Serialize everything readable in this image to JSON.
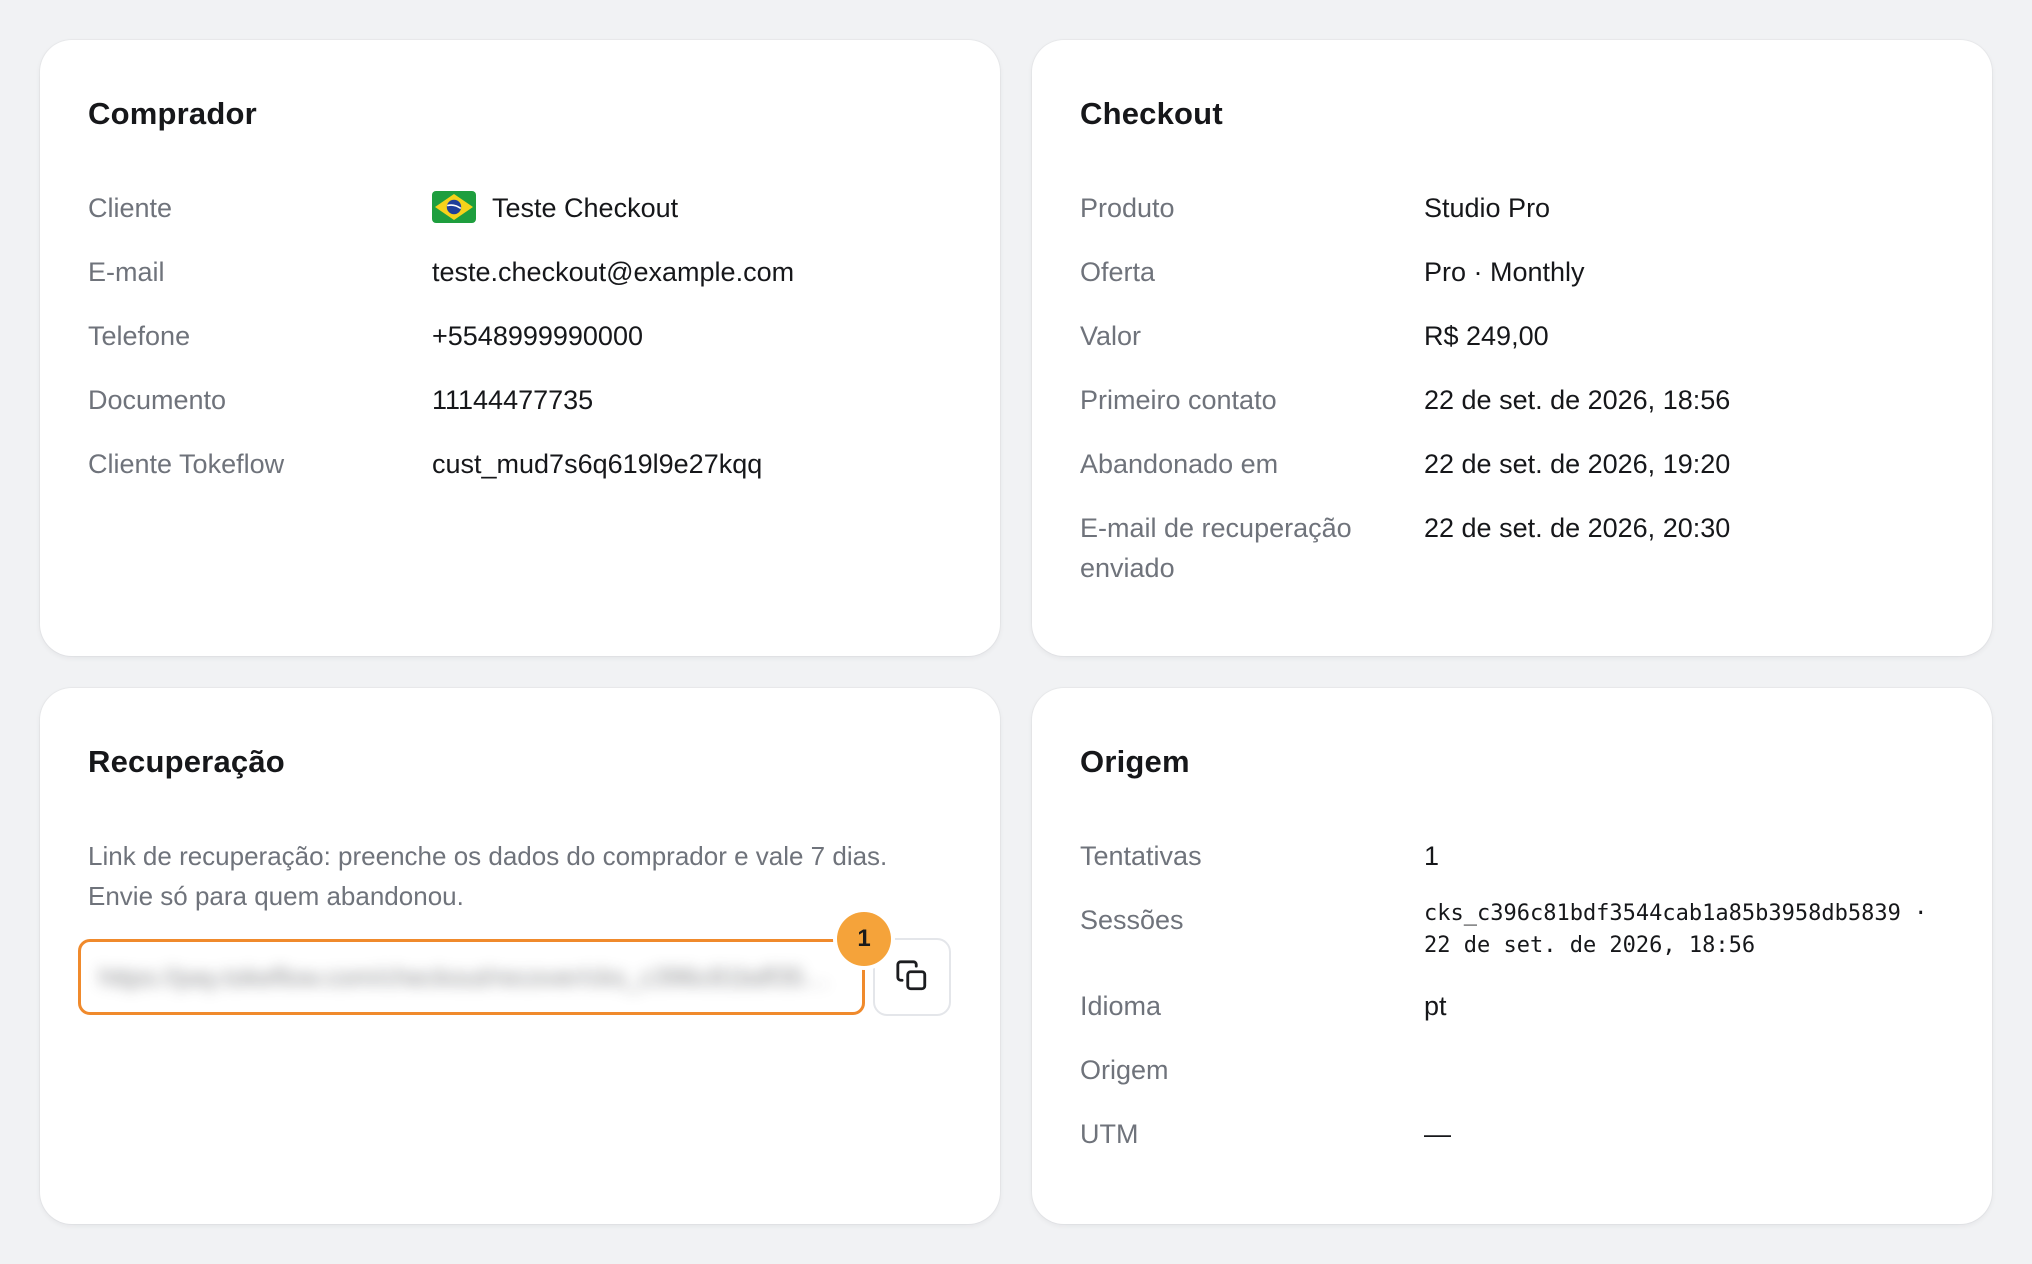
{
  "buyer": {
    "title": "Comprador",
    "rows": [
      {
        "label": "Cliente",
        "value": "Teste Checkout",
        "flag": "brazil-flag-icon"
      },
      {
        "label": "E-mail",
        "value": "teste.checkout@example.com"
      },
      {
        "label": "Telefone",
        "value": "+5548999990000"
      },
      {
        "label": "Documento",
        "value": "11144477735"
      },
      {
        "label": "Cliente Tokeflow",
        "value": "cust_mud7s6q619l9e27kqq"
      }
    ]
  },
  "checkout": {
    "title": "Checkout",
    "rows": [
      {
        "label": "Produto",
        "value": "Studio Pro"
      },
      {
        "label": "Oferta",
        "value": "Pro · Monthly"
      },
      {
        "label": "Valor",
        "value": "R$ 249,00"
      },
      {
        "label": "Primeiro contato",
        "value": "22 de set. de 2026, 18:56"
      },
      {
        "label": "Abandonado em",
        "value": "22 de set. de 2026, 19:20"
      },
      {
        "label": "E-mail de recuperação enviado",
        "value": "22 de set. de 2026, 20:30"
      }
    ]
  },
  "recovery": {
    "title": "Recuperação",
    "description": "Link de recuperação: preenche os dados do comprador e vale 7 dias. Envie só para quem abandonou.",
    "link_value": "https://pay.tokeflow.com/checkout/recover/cks_c396c81bdf3544cab1a85b3958db5839",
    "badge": "1",
    "copy_icon": "copy-icon"
  },
  "origin": {
    "title": "Origem",
    "rows": [
      {
        "label": "Tentativas",
        "value": "1"
      },
      {
        "label": "Sessões",
        "value": "cks_c396c81bdf3544cab1a85b3958db5839 · 22 de set. de 2026, 18:56"
      },
      {
        "label": "Idioma",
        "value": "pt"
      },
      {
        "label": "Origem",
        "value": ""
      },
      {
        "label": "UTM",
        "value": "—"
      }
    ]
  },
  "colors": {
    "accent_orange": "#f08a2c",
    "badge_orange": "#f5a33a",
    "label_gray": "#6f737b",
    "background": "#f1f2f4"
  }
}
